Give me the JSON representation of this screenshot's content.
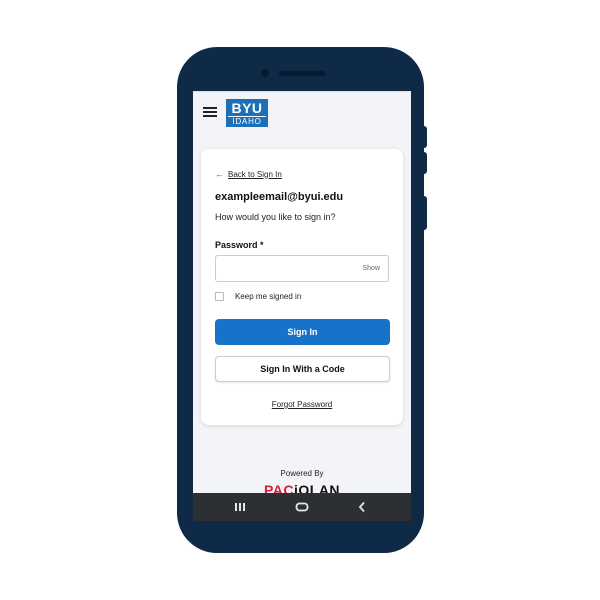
{
  "header": {
    "logo_top": "BYU",
    "logo_bottom": "IDAHO"
  },
  "signin": {
    "back_label": "Back to Sign In",
    "email": "exampleemail@byui.edu",
    "question": "How would you like to sign in?",
    "password_label": "Password *",
    "password_value": "",
    "show_label": "Show",
    "keep_signed_in": "Keep me signed in",
    "signin_button": "Sign In",
    "code_button": "Sign In With a Code",
    "forgot_link": "Forgot Password"
  },
  "footer": {
    "powered_by": "Powered By",
    "brand_red": "PAC",
    "brand_dark": "iOLAN"
  },
  "colors": {
    "phone_frame": "#0e2a47",
    "brand_blue": "#1d6fb8",
    "primary_button": "#1773c9",
    "paciolan_red": "#d51e3a"
  },
  "icons": {
    "menu": "hamburger-menu-icon",
    "back": "arrow-left-icon",
    "nav_recent": "recent-apps-icon",
    "nav_home": "home-icon",
    "nav_back": "back-chevron-icon"
  }
}
